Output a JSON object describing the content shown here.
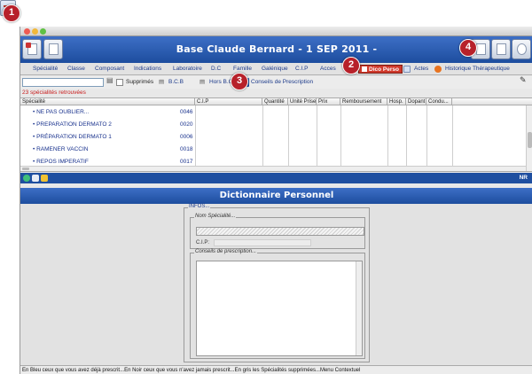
{
  "badges": [
    "1",
    "2",
    "3",
    "4"
  ],
  "window": {
    "title": "Base Claude Bernard - 1 SEP 2011 -"
  },
  "tabs": {
    "items": [
      "Spécialité",
      "Classe",
      "Composant",
      "Indications",
      "Laboratoire",
      "D.C",
      "Famille",
      "Galénique",
      "C.I.P",
      "Acces"
    ],
    "dico": "Dico Perso",
    "actes": "Actes",
    "historique": "Historique Thérapeutique"
  },
  "toolbar": {
    "search_value": "",
    "supprimes": "Supprimés",
    "bcb": "B.C.B",
    "hors": "Hors B.C.",
    "conseils": "Conseils de Prescription"
  },
  "result_count": "23 spécialités retrouvées",
  "table": {
    "columns": [
      "Spécialité",
      "C.I.P",
      "Quantité",
      "Unité Prise",
      "Prix",
      "Remboursement",
      "Hosp.",
      "Dopant",
      "Condu..."
    ],
    "rows": [
      {
        "name": "• NE PAS OUBLIER...",
        "cip": "0046"
      },
      {
        "name": "• PREPARATION DERMATO 2",
        "cip": "0020"
      },
      {
        "name": "• PRÉPARATION DERMATO 1",
        "cip": "0006"
      },
      {
        "name": "• RAMENER VACCIN",
        "cip": "0018"
      },
      {
        "name": "• REPOS IMPERATIF",
        "cip": "0017"
      }
    ]
  },
  "status": {
    "nr": "NR"
  },
  "dictionary": {
    "heading": "Dictionnaire Personnel",
    "infos_legend": "INFOS...",
    "nom_legend": "Nom Spécialité...",
    "cip_label": "C.I.P:",
    "conseils_legend": "Conseils de prescription..."
  },
  "footer": "En Bleu ceux que vous avez déjà prescrit...En Noir ceux que vous n'avez jamais prescrit...En gris les Spécialités supprimées...Menu Contextuel",
  "colors": {
    "header_blue": "#1d4d9e",
    "badge_red": "#b7212a",
    "count_red": "#c81c1c",
    "link_blue": "#17308c"
  }
}
